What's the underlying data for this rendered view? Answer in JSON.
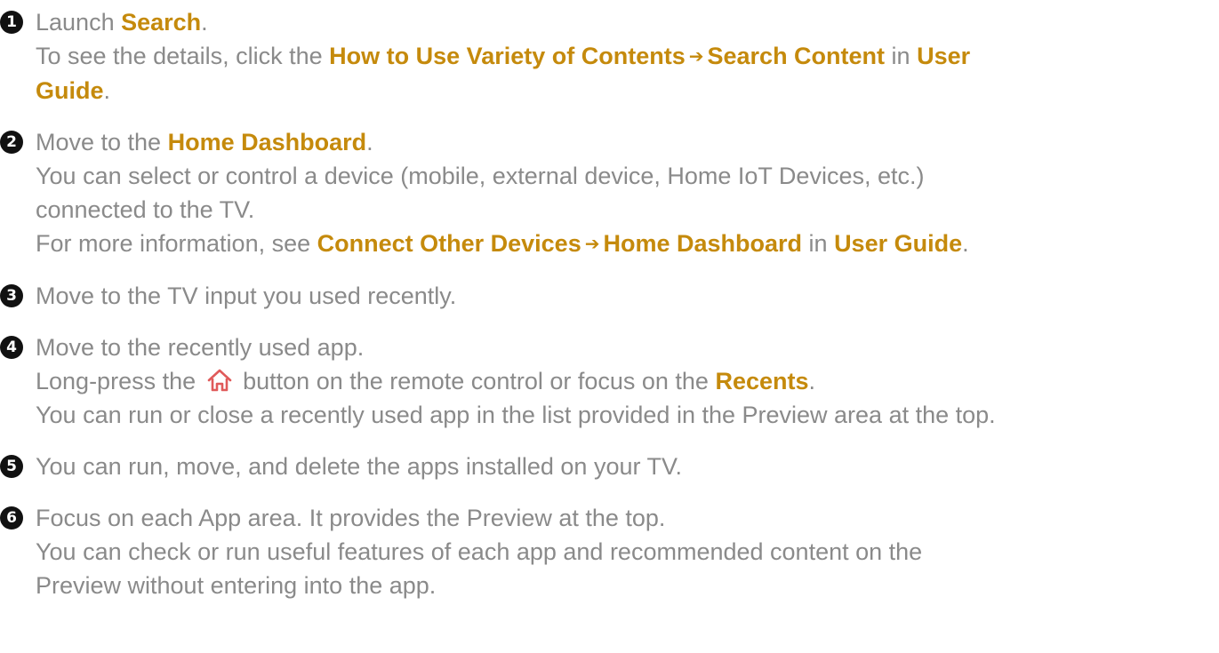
{
  "colors": {
    "text": "#8a8a8a",
    "accent": "#c58a0c",
    "badge": "#111111",
    "icon": "#e05a5a"
  },
  "items": [
    {
      "num": "1",
      "l1": [
        "Launch ",
        "Search",
        "."
      ],
      "l2": [
        "To see the details, click the ",
        "How to Use Variety of Contents",
        "Search Content",
        " in ",
        "User"
      ],
      "l3": [
        "Guide",
        "."
      ]
    },
    {
      "num": "2",
      "l1": [
        "Move to the ",
        "Home Dashboard",
        "."
      ],
      "l2": "You can select or control a device (mobile, external device, Home IoT Devices, etc.)",
      "l3": "connected to the TV.",
      "l4": [
        "For more information, see ",
        "Connect Other Devices",
        "Home Dashboard",
        " in ",
        "User Guide",
        "."
      ]
    },
    {
      "num": "3",
      "l1": "Move to the TV input you used recently."
    },
    {
      "num": "4",
      "l1": "Move to the recently used app.",
      "l2": [
        "Long-press the ",
        " button on the remote control or focus on the ",
        "Recents",
        "."
      ],
      "l3": "You can run or close a recently used app in the list provided in the Preview area at the top."
    },
    {
      "num": "5",
      "l1": "You can run, move, and delete the apps installed on your TV."
    },
    {
      "num": "6",
      "l1": "Focus on each App area. It provides the Preview at the top.",
      "l2": "You can check or run useful features of each app and recommended content on the",
      "l3": "Preview without entering into the app."
    }
  ],
  "icons": {
    "arrow": "arrow-right-icon",
    "home": "home-icon"
  }
}
